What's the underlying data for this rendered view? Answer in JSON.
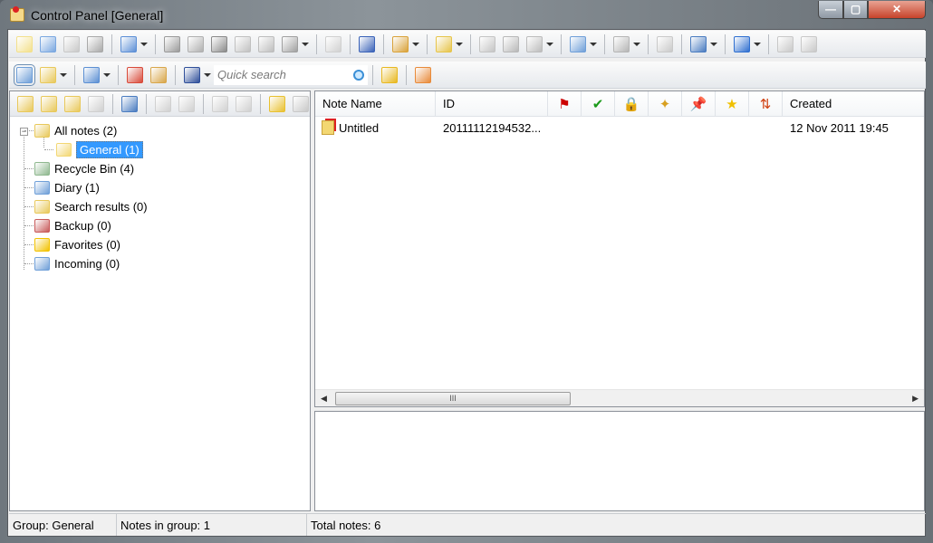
{
  "window": {
    "title": "Control Panel [General]",
    "min": "—",
    "max": "▢",
    "close": "✕"
  },
  "toolbar1": [
    {
      "n": "new-note",
      "c": "#f3e08c"
    },
    {
      "n": "open-note",
      "c": "#7aa7e0"
    },
    {
      "n": "paste",
      "c": "#c8c8c8"
    },
    {
      "n": "copy",
      "c": "#a9a9a9"
    },
    {
      "sep": 1
    },
    {
      "n": "edit",
      "c": "#5c8fd6",
      "dd": 1
    },
    {
      "sep": 1
    },
    {
      "n": "save",
      "c": "#9a9a9a"
    },
    {
      "n": "save-as",
      "c": "#b0b0b0"
    },
    {
      "n": "save-all",
      "c": "#8a8a8a"
    },
    {
      "n": "export",
      "c": "#c0c0c0"
    },
    {
      "n": "print",
      "c": "#bdbdbd"
    },
    {
      "n": "tools",
      "c": "#a0a0a0",
      "dd": 1
    },
    {
      "sep": 1
    },
    {
      "n": "properties",
      "c": "#d0d0d0"
    },
    {
      "sep": 1
    },
    {
      "n": "duplicate",
      "c": "#3a62b8"
    },
    {
      "sep": 1
    },
    {
      "n": "package",
      "c": "#d9a23a",
      "dd": 1
    },
    {
      "sep": 1
    },
    {
      "n": "arrange",
      "c": "#e6c44a",
      "dd": 1
    },
    {
      "sep": 1
    },
    {
      "n": "mail",
      "c": "#c4c4c4"
    },
    {
      "n": "attach",
      "c": "#b8b8b8"
    },
    {
      "n": "send",
      "c": "#bcbcbc",
      "dd": 1
    },
    {
      "sep": 1
    },
    {
      "n": "calendar",
      "c": "#6f9fd8",
      "dd": 1
    },
    {
      "sep": 1
    },
    {
      "n": "check",
      "c": "#b5b5b5",
      "dd": 1
    },
    {
      "sep": 1
    },
    {
      "n": "favorite",
      "c": "#c9c9c9"
    },
    {
      "sep": 1
    },
    {
      "n": "find",
      "c": "#4a7cc0",
      "dd": 1
    },
    {
      "sep": 1
    },
    {
      "n": "play",
      "c": "#2f6fd0",
      "dd": 1
    },
    {
      "sep": 1
    },
    {
      "n": "lock",
      "c": "#c8c8c8"
    },
    {
      "n": "unlock",
      "c": "#c8c8c8"
    }
  ],
  "toolbar2": [
    {
      "n": "view-list",
      "c": "#6f9fd8",
      "act": 1
    },
    {
      "n": "view-panel",
      "c": "#e8c85a",
      "dd": 1
    },
    {
      "sep": 1
    },
    {
      "n": "columns",
      "c": "#5b8fd3",
      "dd": 1
    },
    {
      "sep": 1
    },
    {
      "n": "note-info",
      "c": "#d84a3a"
    },
    {
      "n": "keyboard",
      "c": "#d8a64a"
    },
    {
      "sep": 1
    },
    {
      "n": "binoculars",
      "c": "#2f4f9a",
      "dd": 1
    },
    {
      "search": 1
    },
    {
      "sep": 1
    },
    {
      "n": "help",
      "c": "#e8b820"
    },
    {
      "sep": 1
    },
    {
      "n": "layout",
      "c": "#e88a3a"
    }
  ],
  "search": {
    "placeholder": "Quick search"
  },
  "left_toolbar": [
    {
      "n": "new-group",
      "c": "#e8c85a"
    },
    {
      "n": "new-subgroup",
      "c": "#e8c85a"
    },
    {
      "n": "rename-group",
      "c": "#e8c85a"
    },
    {
      "n": "delete-group",
      "c": "#cfcfcf"
    },
    {
      "sep": 1
    },
    {
      "n": "group-properties",
      "c": "#4a7cc0"
    },
    {
      "sep": 1
    },
    {
      "n": "collapse",
      "c": "#d0d0d0"
    },
    {
      "n": "expand",
      "c": "#d0d0d0"
    },
    {
      "sep": 1
    },
    {
      "n": "move-left",
      "c": "#d0d0d0"
    },
    {
      "n": "move-right",
      "c": "#d0d0d0"
    },
    {
      "sep": 1
    },
    {
      "n": "add-shared",
      "c": "#e8c030"
    },
    {
      "n": "remove-shared",
      "c": "#c8c8c8"
    }
  ],
  "tree": [
    {
      "label": "All notes (2)",
      "icon": "all-notes",
      "c": "#e8c85a"
    },
    {
      "label": "General (1)",
      "icon": "folder",
      "c": "#f3d772",
      "selected": true
    },
    {
      "label": "Recycle Bin (4)",
      "icon": "recycle-bin",
      "c": "#8fb88f"
    },
    {
      "label": "Diary (1)",
      "icon": "diary",
      "c": "#6f9fd8"
    },
    {
      "label": "Search results (0)",
      "icon": "search-results",
      "c": "#e8c85a"
    },
    {
      "label": "Backup (0)",
      "icon": "backup",
      "c": "#c85a5a"
    },
    {
      "label": "Favorites (0)",
      "icon": "favorites",
      "c": "#f2c200"
    },
    {
      "label": "Incoming (0)",
      "icon": "incoming",
      "c": "#6f9fd8"
    }
  ],
  "list": {
    "columns": [
      "Note Name",
      "ID",
      "Created"
    ],
    "icon_columns": [
      {
        "n": "flag",
        "g": "⚑",
        "c": "#c00"
      },
      {
        "n": "completed",
        "g": "✔",
        "c": "#1a9a1a"
      },
      {
        "n": "locked",
        "g": "🔒",
        "c": "#c89a20"
      },
      {
        "n": "link",
        "g": "✦",
        "c": "#d8a020"
      },
      {
        "n": "pin",
        "g": "📌",
        "c": "#d22"
      },
      {
        "n": "star",
        "g": "★",
        "c": "#f0c000"
      },
      {
        "n": "priority",
        "g": "⇅",
        "c": "#d04010"
      }
    ],
    "rows": [
      {
        "name": "Untitled",
        "id": "20111112194532...",
        "created": "12 Nov 2011 19:45"
      }
    ],
    "scroll_grip": "III"
  },
  "status": {
    "group": "Group: General",
    "notes_in_group": "Notes in group: 1",
    "total": "Total notes: 6"
  }
}
